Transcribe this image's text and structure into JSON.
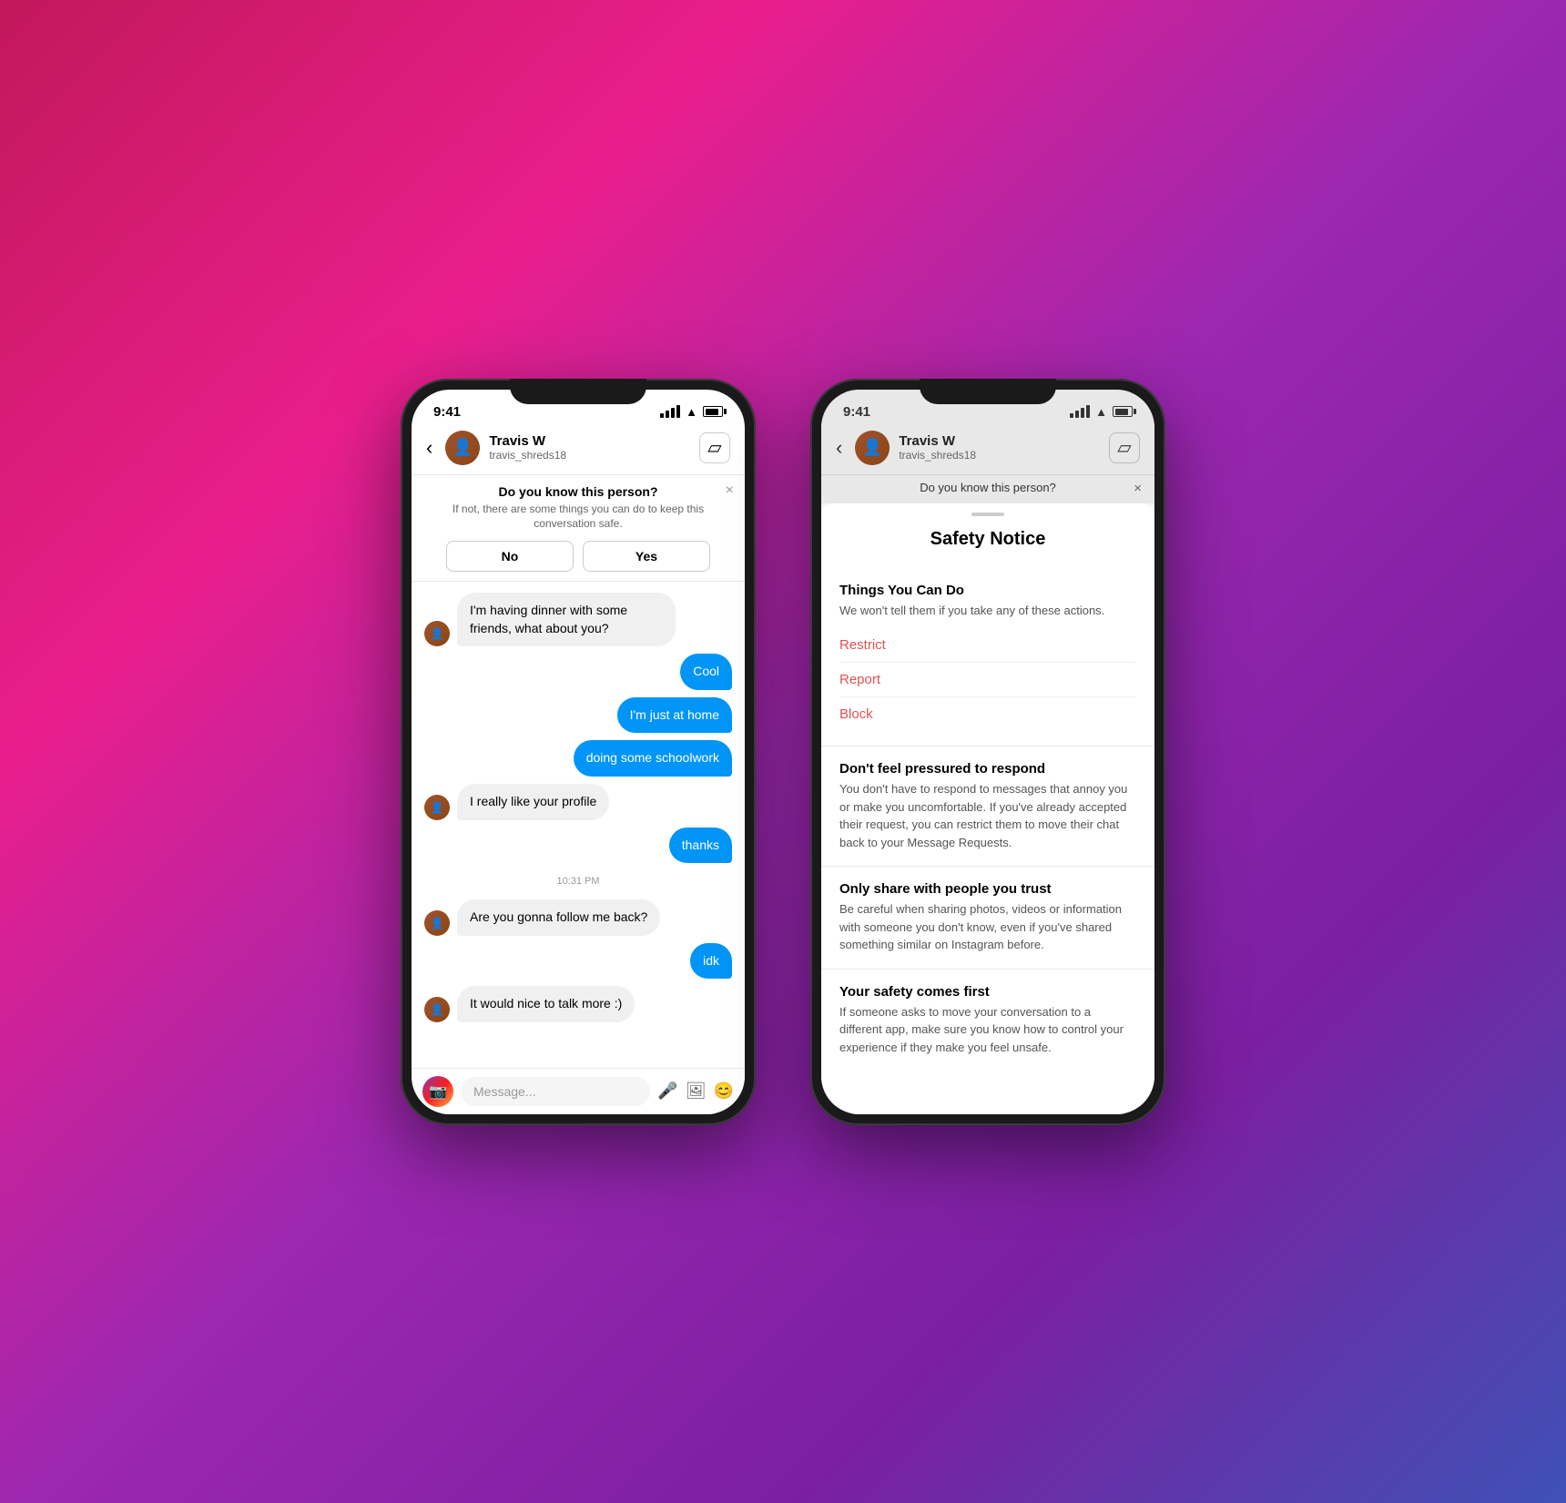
{
  "phone1": {
    "statusBar": {
      "time": "9:41"
    },
    "header": {
      "backLabel": "‹",
      "contactName": "Travis W",
      "contactHandle": "travis_shreds18",
      "videoIcon": "□"
    },
    "knowBanner": {
      "title": "Do you know this person?",
      "subtitle": "If not, there are some things you can do to keep this conversation safe.",
      "noLabel": "No",
      "yesLabel": "Yes",
      "closeIcon": "×"
    },
    "messages": [
      {
        "id": 1,
        "type": "incoming",
        "text": "I'm having dinner with some friends, what about you?"
      },
      {
        "id": 2,
        "type": "outgoing",
        "text": "Cool"
      },
      {
        "id": 3,
        "type": "outgoing",
        "text": "I'm just at home"
      },
      {
        "id": 4,
        "type": "outgoing",
        "text": "doing some schoolwork"
      },
      {
        "id": 5,
        "type": "incoming",
        "text": "I really like your profile"
      },
      {
        "id": 6,
        "type": "outgoing",
        "text": "thanks"
      },
      {
        "id": 7,
        "type": "time",
        "text": "10:31 PM"
      },
      {
        "id": 8,
        "type": "incoming",
        "text": "Are you gonna follow me back?"
      },
      {
        "id": 9,
        "type": "outgoing",
        "text": "idk"
      },
      {
        "id": 10,
        "type": "incoming",
        "text": "It would nice to talk more :)"
      }
    ],
    "inputBar": {
      "placeholder": "Message...",
      "micIcon": "🎤",
      "galleryIcon": "🖼",
      "stickerIcon": "😊"
    }
  },
  "phone2": {
    "statusBar": {
      "time": "9:41"
    },
    "header": {
      "backLabel": "‹",
      "contactName": "Travis W",
      "contactHandle": "travis_shreds18",
      "videoIcon": "□"
    },
    "knowBanner": {
      "title": "Do you know this person?",
      "closeIcon": "×"
    },
    "safetyNotice": {
      "title": "Safety Notice",
      "thingsSection": {
        "heading": "Things You Can Do",
        "subtext": "We won't tell them if you take any of these actions.",
        "actions": [
          "Restrict",
          "Report",
          "Block"
        ]
      },
      "sections": [
        {
          "heading": "Don't feel pressured to respond",
          "text": "You don't have to respond to messages that annoy you or make you uncomfortable. If you've already accepted their request, you can restrict them to move their chat back to your Message Requests."
        },
        {
          "heading": "Only share with people you trust",
          "text": "Be careful when sharing photos, videos or information with someone you don't know, even if you've shared something similar on Instagram before."
        },
        {
          "heading": "Your safety comes first",
          "text": "If someone asks to move your conversation to a different app, make sure you know how to control your experience if they make you feel unsafe."
        }
      ]
    }
  }
}
